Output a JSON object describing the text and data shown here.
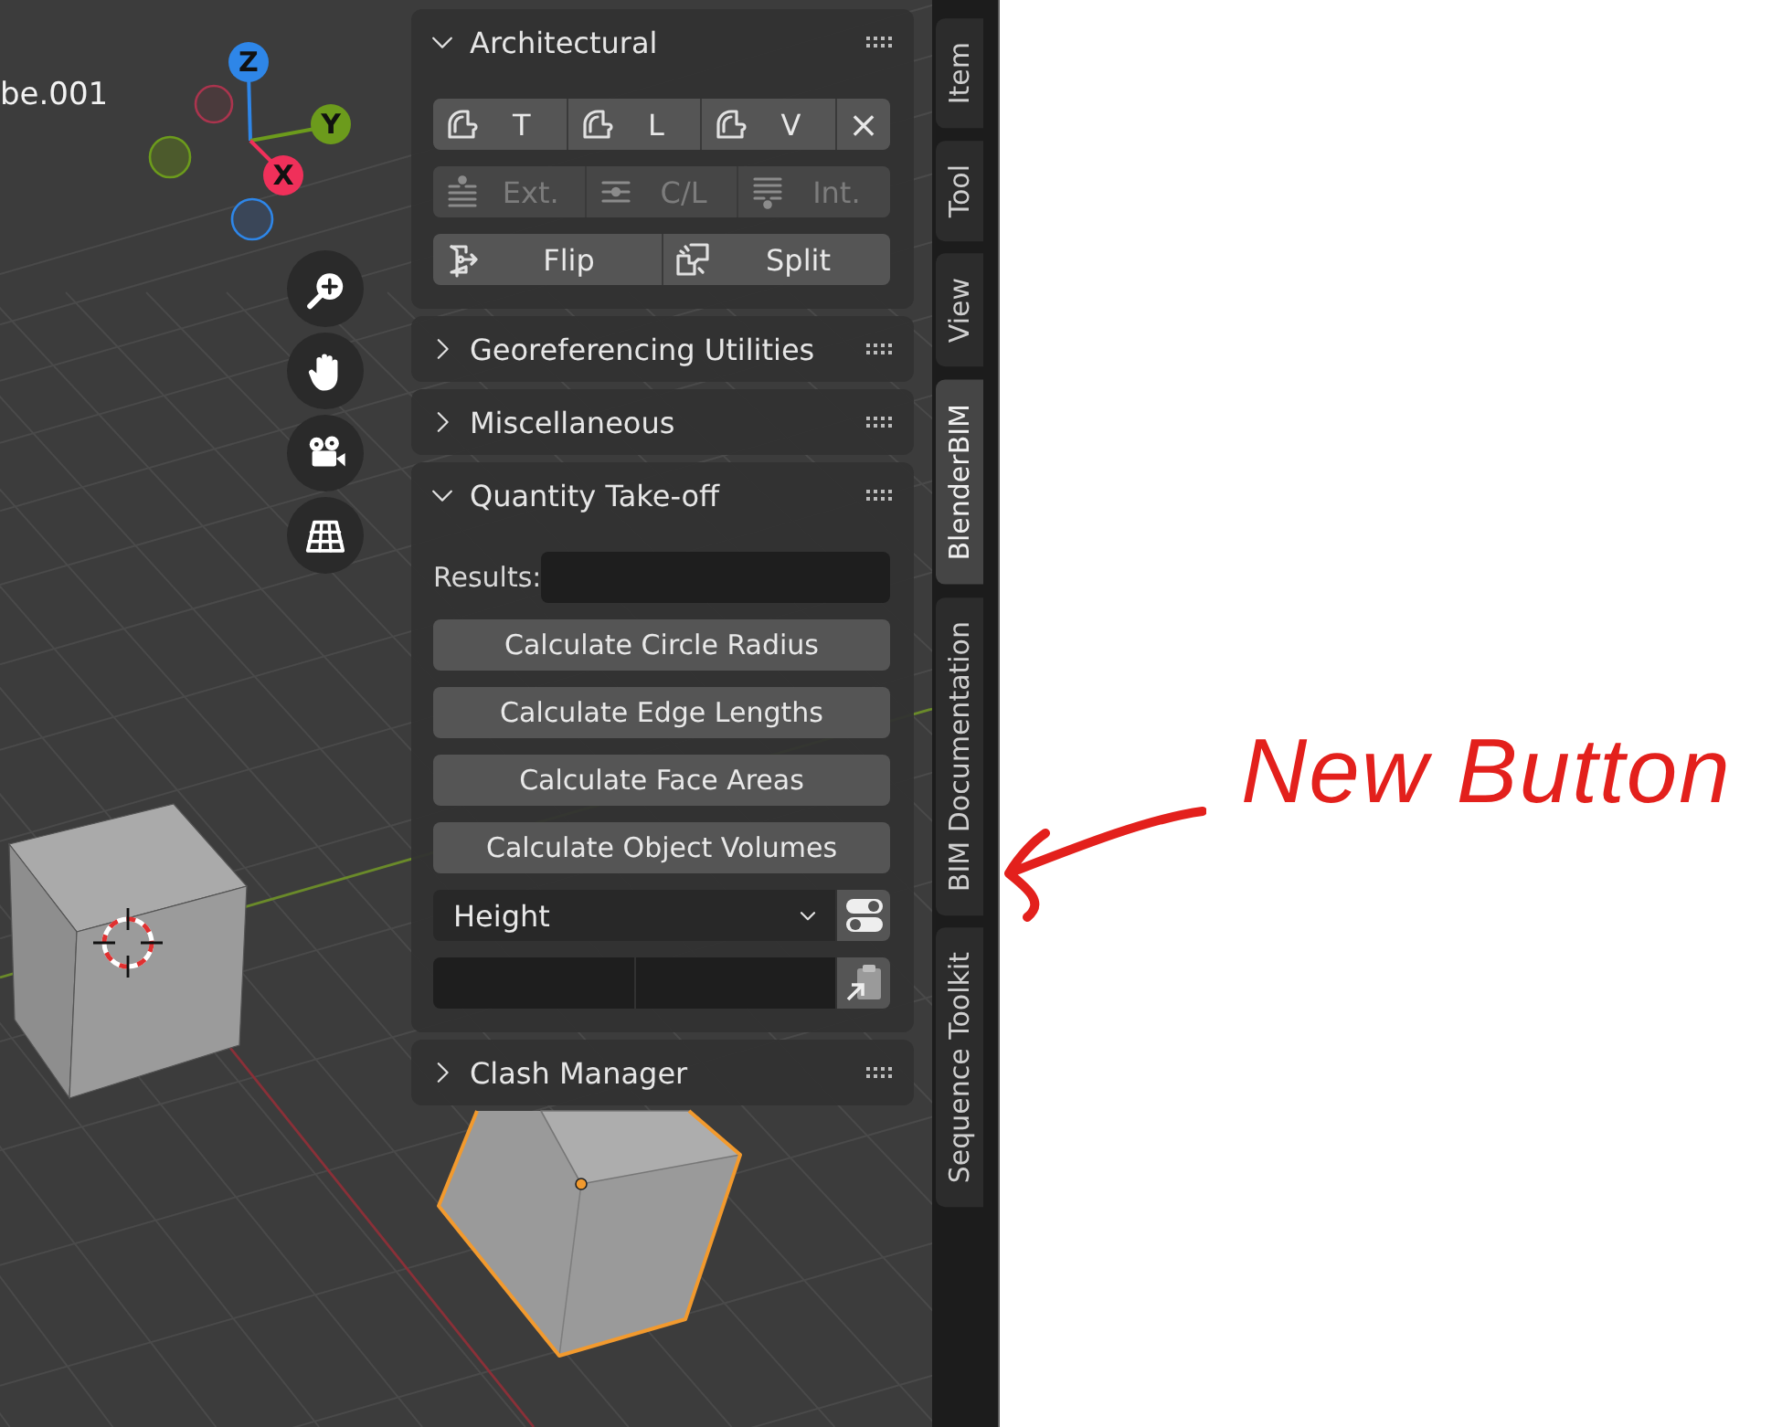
{
  "viewport": {
    "object_name": "be.001",
    "gizmo_axes": [
      {
        "label": "Z",
        "color": "#2e86e8"
      },
      {
        "label": "Y",
        "color": "#6c9b1c"
      },
      {
        "label": "X",
        "color": "#f0305a"
      }
    ]
  },
  "sidebar": {
    "panels": [
      {
        "title": "Architectural",
        "expanded": true,
        "rows": [
          {
            "kind": "buttons",
            "disabled": false,
            "items": [
              {
                "label": "T"
              },
              {
                "label": "L"
              },
              {
                "label": "V"
              },
              {
                "label": "×"
              }
            ]
          },
          {
            "kind": "buttons",
            "disabled": true,
            "items": [
              {
                "label": "Ext."
              },
              {
                "label": "C/L"
              },
              {
                "label": "Int."
              }
            ]
          },
          {
            "kind": "buttons",
            "disabled": false,
            "items": [
              {
                "label": "Flip"
              },
              {
                "label": "Split"
              }
            ]
          }
        ]
      },
      {
        "title": "Georeferencing Utilities",
        "expanded": false
      },
      {
        "title": "Miscellaneous",
        "expanded": false
      },
      {
        "title": "Quantity Take-off",
        "expanded": true,
        "rows": [
          {
            "kind": "field",
            "label": "Results:"
          },
          {
            "kind": "button",
            "label": "Calculate Circle Radius"
          },
          {
            "kind": "button",
            "label": "Calculate Edge Lengths"
          },
          {
            "kind": "button",
            "label": "Calculate Face Areas"
          },
          {
            "kind": "button",
            "label": "Calculate Object Volumes"
          },
          {
            "kind": "dropdown",
            "value": "Height"
          },
          {
            "kind": "vector"
          }
        ]
      },
      {
        "title": "Clash Manager",
        "expanded": false
      }
    ]
  },
  "tabs": [
    {
      "label": "Item",
      "selected": false
    },
    {
      "label": "Tool",
      "selected": false
    },
    {
      "label": "View",
      "selected": false
    },
    {
      "label": "BlenderBIM",
      "selected": true
    },
    {
      "label": "BIM Documentation",
      "selected": false
    },
    {
      "label": "Sequence Toolkit",
      "selected": false
    }
  ],
  "annotation": {
    "text": "New Button"
  }
}
